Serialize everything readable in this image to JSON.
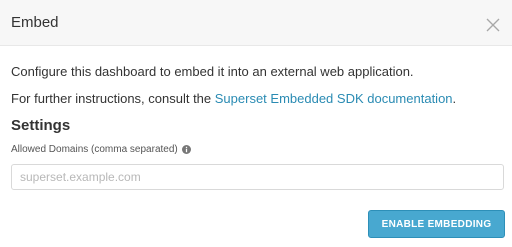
{
  "modal": {
    "title": "Embed",
    "close_icon": "close-icon"
  },
  "body": {
    "description": "Configure this dashboard to embed it into an external web application.",
    "instructions_prefix": "For further instructions, consult the ",
    "doc_link_label": "Superset Embedded SDK documentation",
    "instructions_suffix": "."
  },
  "settings": {
    "heading": "Settings",
    "allowed_domains_label": "Allowed Domains (comma separated)",
    "info_icon": "info-icon",
    "allowed_domains_value": "",
    "allowed_domains_placeholder": "superset.example.com"
  },
  "footer": {
    "enable_button_label": "ENABLE EMBEDDING"
  },
  "colors": {
    "primary": "#48a8d0",
    "link": "#2a8bb3",
    "header_bg": "#f7f7f7"
  }
}
